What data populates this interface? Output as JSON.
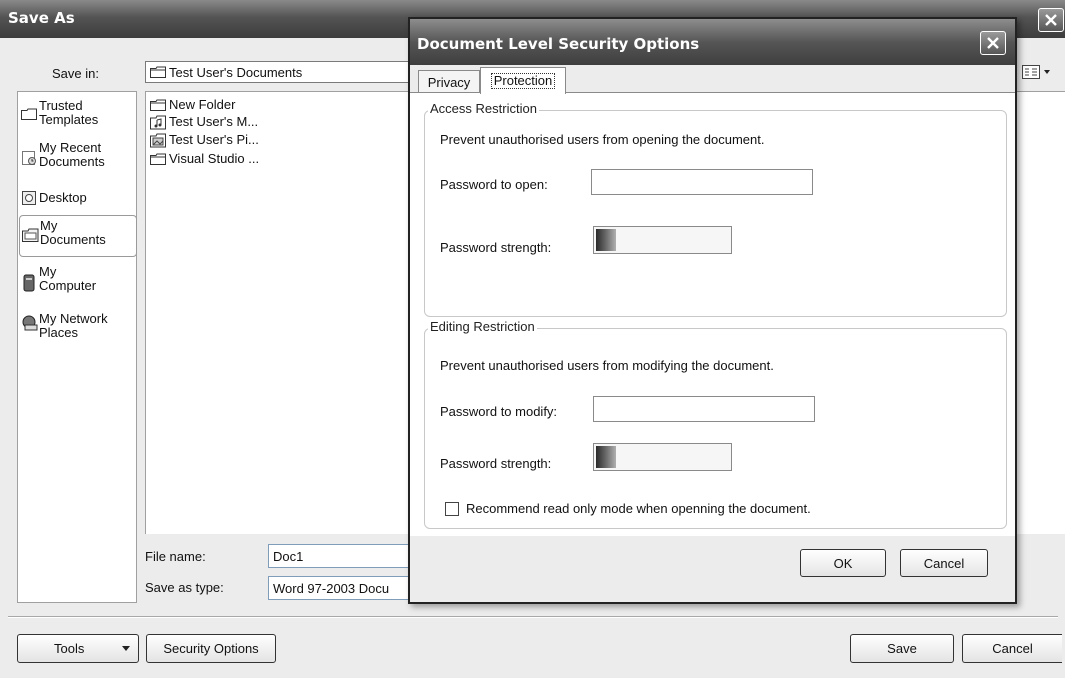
{
  "save_as": {
    "title": "Save As",
    "save_in_label": "Save in:",
    "save_in_value": "Test User's Documents",
    "places": [
      {
        "label": "Trusted Templates",
        "lines": [
          "Trusted",
          "Templates"
        ],
        "icon": "folder-icon"
      },
      {
        "label": "My Recent Documents",
        "lines": [
          "My Recent",
          "Documents"
        ],
        "icon": "recent-documents-icon"
      },
      {
        "label": "Desktop",
        "lines": [
          "Desktop"
        ],
        "icon": "desktop-icon"
      },
      {
        "label": "My Documents",
        "lines": [
          "My",
          "Documents"
        ],
        "icon": "my-documents-icon",
        "selected": true
      },
      {
        "label": "My Computer",
        "lines": [
          "My",
          "Computer"
        ],
        "icon": "computer-icon"
      },
      {
        "label": "My Network Places",
        "lines": [
          "My Network",
          "Places"
        ],
        "icon": "network-icon"
      }
    ],
    "files": [
      {
        "name": "New Folder",
        "icon": "folder-icon"
      },
      {
        "name": "Test User's M...",
        "icon": "music-folder-icon"
      },
      {
        "name": "Test User's Pi...",
        "icon": "pictures-folder-icon"
      },
      {
        "name": "Visual Studio ...",
        "icon": "folder-icon"
      }
    ],
    "file_name_label": "File name:",
    "file_name_value": "Doc1",
    "save_as_type_label": "Save as type:",
    "save_as_type_value": "Word 97-2003 Docu",
    "tools_button": "Tools",
    "security_options_button": "Security Options",
    "save_button": "Save",
    "cancel_button": "Cancel"
  },
  "security_dialog": {
    "title": "Document Level Security Options",
    "tabs": [
      {
        "label": "Privacy",
        "active": false
      },
      {
        "label": "Protection",
        "active": true
      }
    ],
    "access_restriction": {
      "title": "Access Restriction",
      "description": "Prevent unauthorised users from opening the document.",
      "password_label": "Password to open:",
      "password_value": "",
      "strength_label": "Password strength:",
      "strength_level": 0.15
    },
    "editing_restriction": {
      "title": "Editing Restriction",
      "description": "Prevent unauthorised users from modifying the document.",
      "password_label": "Password to modify:",
      "password_value": "",
      "strength_label": "Password strength:",
      "strength_level": 0.15,
      "recommend_label": "Recommend read only mode when openning the document.",
      "recommend_checked": false
    },
    "ok_button": "OK",
    "cancel_button": "Cancel"
  }
}
